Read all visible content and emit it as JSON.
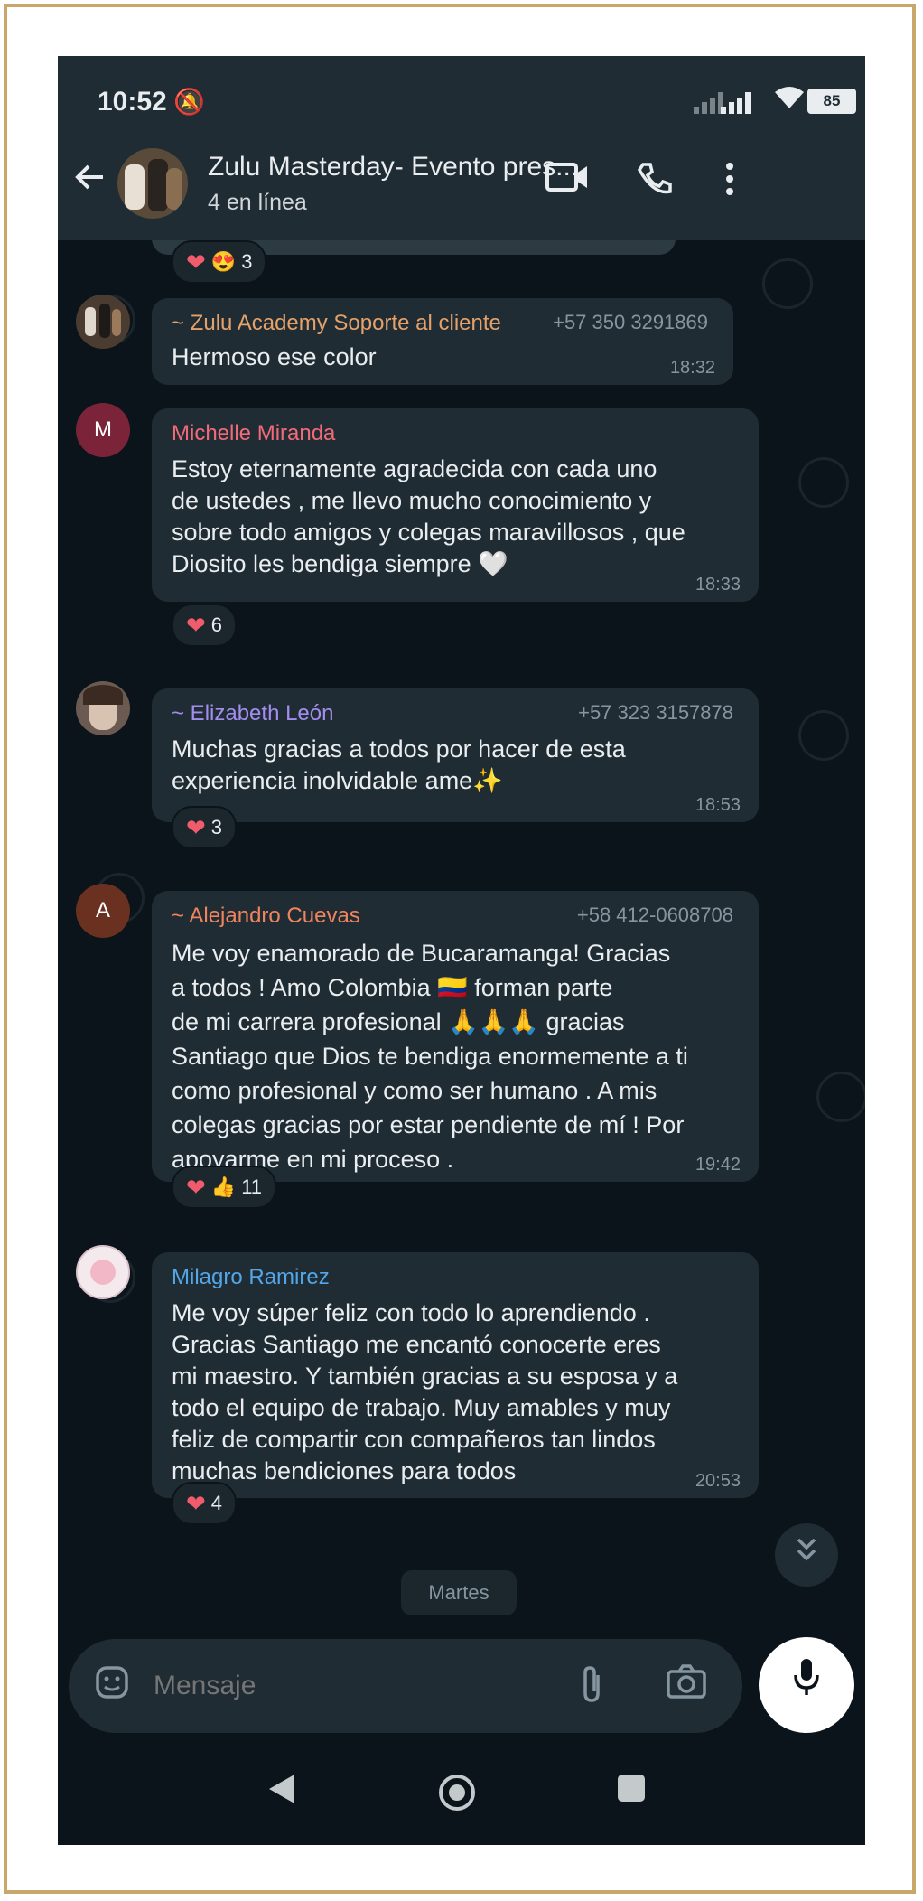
{
  "status_bar": {
    "time": "10:52",
    "battery": "85"
  },
  "header": {
    "title": "Zulu Masterday- Evento pres...",
    "subtitle": "4 en línea",
    "icons": [
      "back-arrow-icon",
      "video-call-icon",
      "phone-call-icon",
      "more-options-icon"
    ]
  },
  "messages": [
    {
      "reactions": "3"
    },
    {
      "sender": "~ Zulu Academy Soporte al cliente",
      "phone": "+57 350 3291869",
      "text": "Hermoso ese color",
      "time": "18:32",
      "name_color": "#e5a16a"
    },
    {
      "avatar_letter": "M",
      "avatar_color": "#7b2439",
      "sender": "Michelle Miranda",
      "text": "Estoy eternamente agradecida con cada uno\nde ustedes , me llevo mucho conocimiento y\nsobre todo amigos y colegas maravillosos , que\nDiosito les bendiga siempre 🤍",
      "time": "18:33",
      "reactions": "6",
      "name_color": "#f16a7a"
    },
    {
      "sender": "~ Elizabeth León",
      "phone": "+57 323 3157878",
      "text": "Muchas gracias a todos por hacer de esta\nexperiencia inolvidable ame✨",
      "time": "18:53",
      "reactions": "3",
      "name_color": "#a48df0"
    },
    {
      "avatar_letter": "A",
      "avatar_color": "#6a3020",
      "sender": "~ Alejandro Cuevas",
      "phone": "+58 412-0608708",
      "text": "Me voy enamorado de Bucaramanga! Gracias\na todos ! Amo Colombia 🇨🇴 forman parte\nde mi carrera profesional 🙏🙏🙏 gracias\nSantiago que Dios te bendiga enormemente a ti\ncomo profesional y como ser  humano . A mis\ncolegas gracias por estar pendiente de mí ! Por\napoyarme en mi proceso .",
      "time": "19:42",
      "reactions": "11",
      "name_color": "#f0855d"
    },
    {
      "sender": "Milagro Ramirez",
      "text": "Me voy súper feliz con todo lo aprendiendo .\nGracias Santiago me encantó conocerte eres\nmi maestro. Y también gracias a su esposa y a\ntodo el equipo de trabajo. Muy amables y muy\nfeliz de  compartir con compañeros tan lindos\nmuchas bendiciones para todos",
      "time": "20:53",
      "reactions": "4",
      "name_color": "#53a6e8"
    }
  ],
  "date_divider": "Martes",
  "input": {
    "placeholder": "Mensaje"
  },
  "colors": {
    "chat_bg": "#0b141a",
    "bubble_bg": "#202c33",
    "header_bg": "#1f2c33",
    "reaction_heart": "#f15c6d",
    "frame_border": "#c9a76a"
  }
}
